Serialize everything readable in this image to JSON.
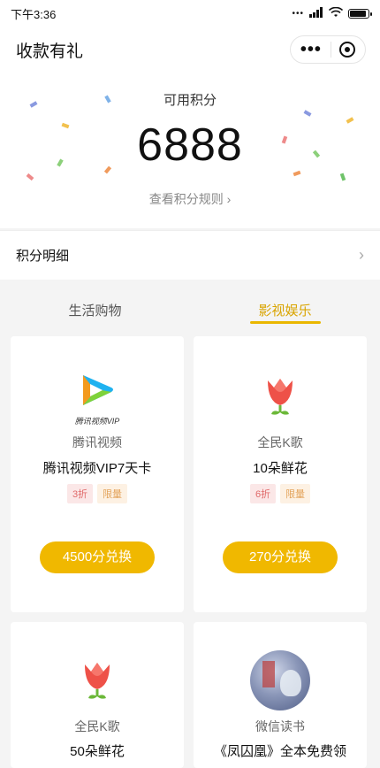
{
  "status_bar": {
    "time": "下午3:36",
    "dots": "•••",
    "signal": "4G",
    "wifi": "wifi-icon",
    "battery_level": 0.9
  },
  "nav": {
    "title": "收款有礼",
    "more_icon": "more-dots-icon",
    "close_icon": "target-icon"
  },
  "points": {
    "label": "可用积分",
    "value": "6888",
    "rules_link": "查看积分规则 ›"
  },
  "detail": {
    "label": "积分明细",
    "chevron": "›"
  },
  "tabs": [
    {
      "label": "生活购物"
    },
    {
      "label": "影视娱乐"
    }
  ],
  "active_tab": 1,
  "cards": [
    {
      "brand": "腾讯视频",
      "name": "腾讯视频VIP7天卡",
      "icon": "tencent-video-vip-icon",
      "icon_caption": "腾讯视频VIP",
      "discount": "3折",
      "limit": "限量",
      "button": "4500分兑换"
    },
    {
      "brand": "全民K歌",
      "name": "10朵鲜花",
      "icon": "flower-icon",
      "discount": "6折",
      "limit": "限量",
      "button": "270分兑换"
    },
    {
      "brand": "全民K歌",
      "name": "50朵鲜花",
      "icon": "flower-icon"
    },
    {
      "brand": "微信读书",
      "name": "《凤囚凰》全本免费领",
      "icon": "book-cover-icon"
    }
  ],
  "colors": {
    "accent": "#f0b800",
    "active_tab": "#d9a400",
    "discount_tag": "#e06a6a",
    "limit_tag": "#e3a35a"
  }
}
